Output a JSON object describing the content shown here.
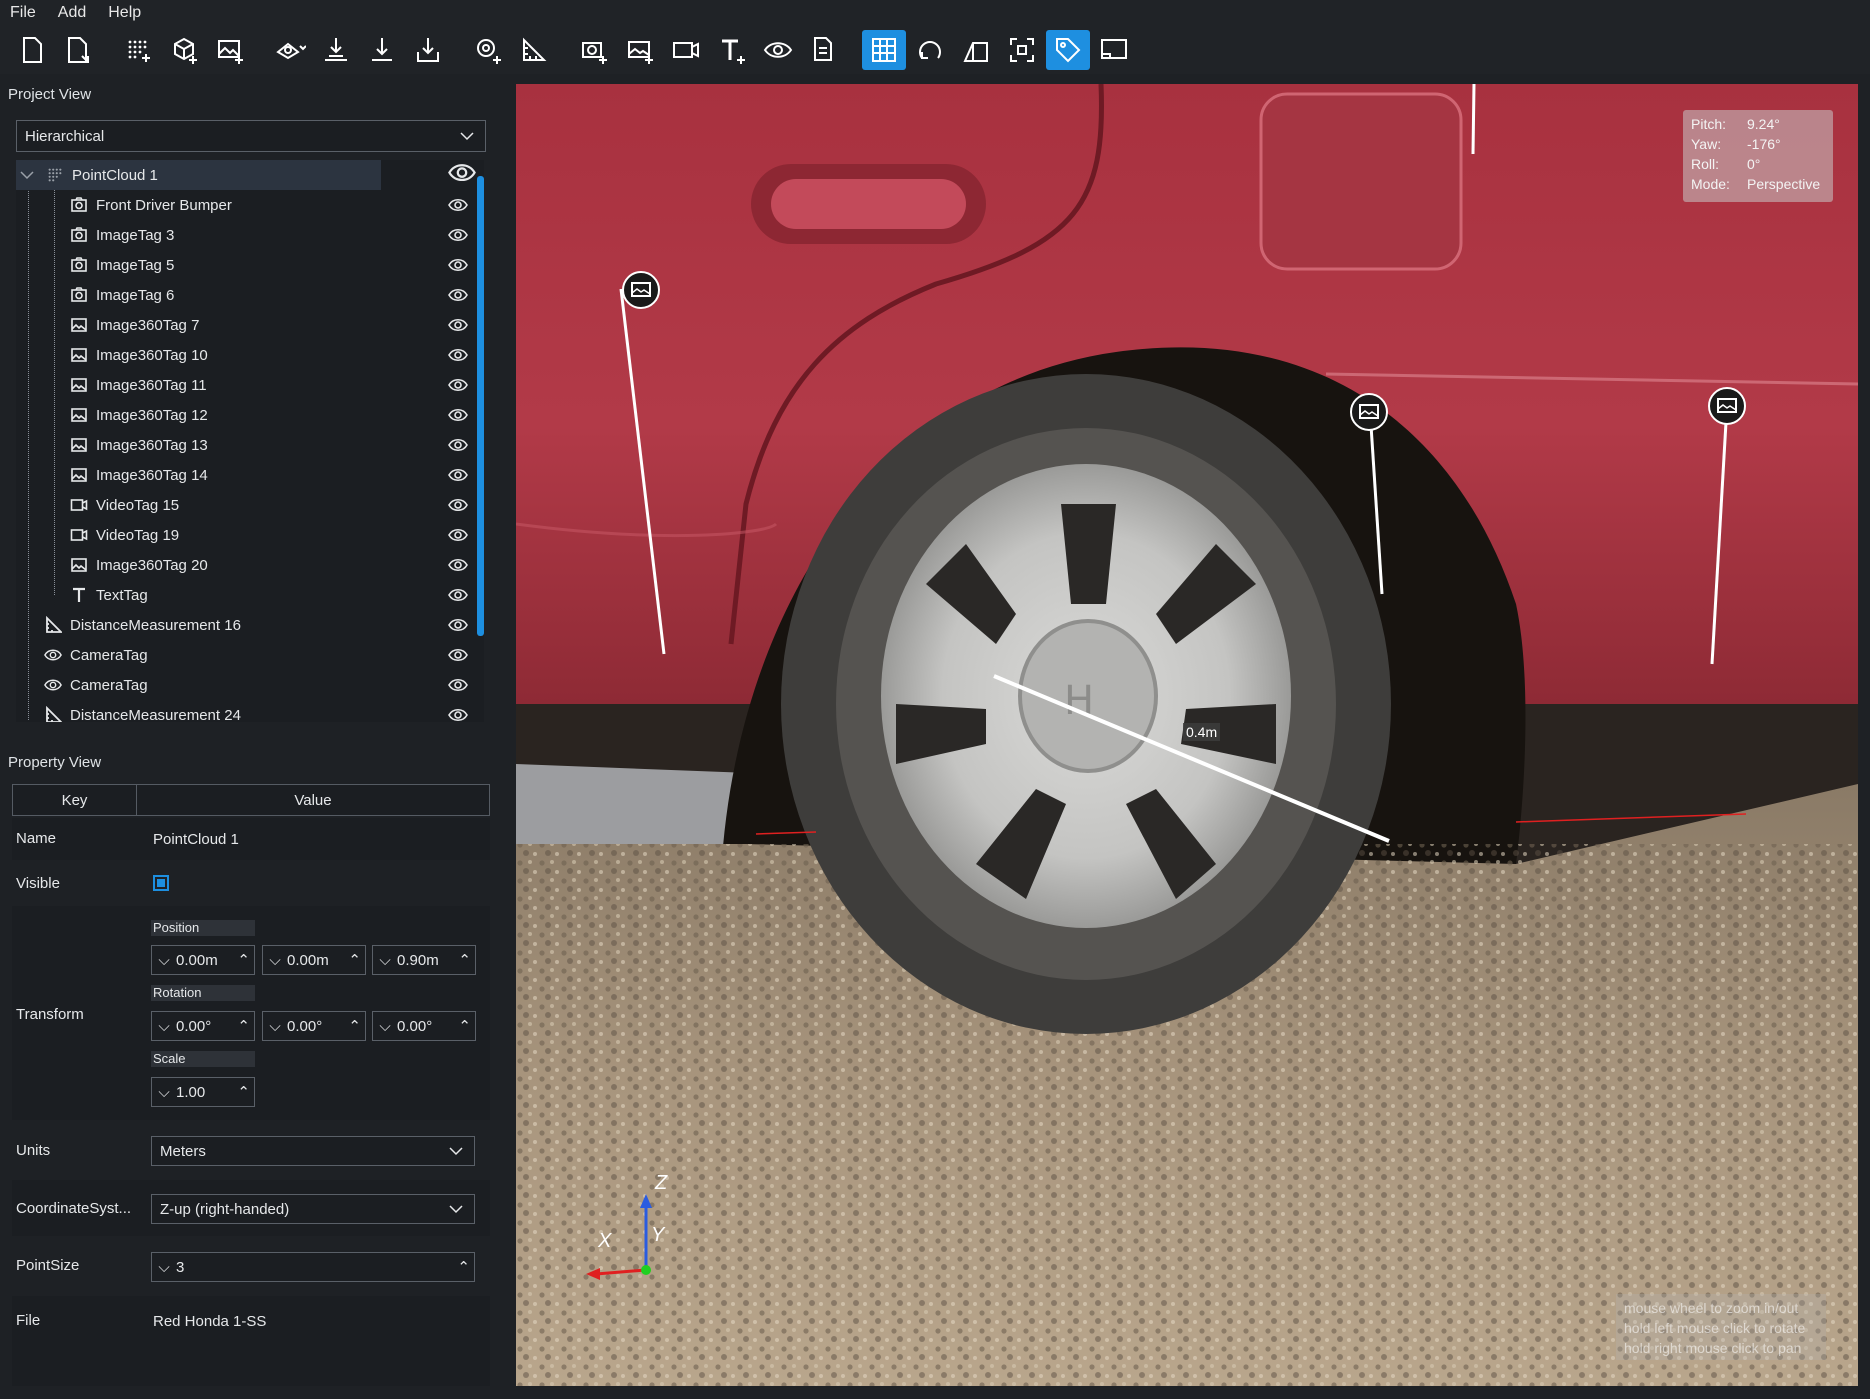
{
  "menu": [
    "File",
    "Add",
    "Help"
  ],
  "toolbar": {
    "icons": [
      "new-file-icon",
      "open-file-icon",
      "add-pointcloud-icon",
      "add-model-icon",
      "add-image-icon",
      "transform-icon",
      "drop-icon",
      "ground-icon",
      "import-icon",
      "pin-icon",
      "measure-icon",
      "camera-tag-icon",
      "image360-tag-icon",
      "video-tag-icon",
      "text-tag-icon",
      "eye-tag-icon",
      "doc-tag-icon",
      "grid-icon",
      "orbit-icon",
      "perspective-icon",
      "fit-icon",
      "tag-icon",
      "screen-icon"
    ],
    "active": [
      "grid-icon",
      "tag-icon"
    ]
  },
  "project_view": {
    "title": "Project View",
    "mode": "Hierarchical",
    "items": [
      {
        "label": "PointCloud 1",
        "icon": "pointcloud-icon",
        "level": 0
      },
      {
        "label": "Front Driver Bumper",
        "icon": "camera-icon",
        "level": 1
      },
      {
        "label": "ImageTag 3",
        "icon": "camera-icon",
        "level": 1
      },
      {
        "label": "ImageTag 5",
        "icon": "camera-icon",
        "level": 1
      },
      {
        "label": "ImageTag 6",
        "icon": "camera-icon",
        "level": 1
      },
      {
        "label": "Image360Tag 7",
        "icon": "image360-icon",
        "level": 1
      },
      {
        "label": "Image360Tag 10",
        "icon": "image360-icon",
        "level": 1
      },
      {
        "label": "Image360Tag 11",
        "icon": "image360-icon",
        "level": 1
      },
      {
        "label": "Image360Tag 12",
        "icon": "image360-icon",
        "level": 1
      },
      {
        "label": "Image360Tag 13",
        "icon": "image360-icon",
        "level": 1
      },
      {
        "label": "Image360Tag 14",
        "icon": "image360-icon",
        "level": 1
      },
      {
        "label": "VideoTag 15",
        "icon": "video-icon",
        "level": 1
      },
      {
        "label": "VideoTag 19",
        "icon": "video-icon",
        "level": 1
      },
      {
        "label": "Image360Tag 20",
        "icon": "image360-icon",
        "level": 1
      },
      {
        "label": "TextTag",
        "icon": "text-icon",
        "level": 1
      },
      {
        "label": "DistanceMeasurement 16",
        "icon": "measure-icon",
        "level": 0
      },
      {
        "label": "CameraTag",
        "icon": "eye-icon",
        "level": 0
      },
      {
        "label": "CameraTag",
        "icon": "eye-icon",
        "level": 0
      },
      {
        "label": "DistanceMeasurement 24",
        "icon": "measure-icon",
        "level": 0
      }
    ]
  },
  "property_view": {
    "title": "Property View",
    "header_key": "Key",
    "header_value": "Value",
    "name_key": "Name",
    "name_value": "PointCloud 1",
    "visible_key": "Visible",
    "transform_key": "Transform",
    "position_label": "Position",
    "position": [
      "0.00m",
      "0.00m",
      "0.90m"
    ],
    "rotation_label": "Rotation",
    "rotation": [
      "0.00°",
      "0.00°",
      "0.00°"
    ],
    "scale_label": "Scale",
    "scale": "1.00",
    "units_key": "Units",
    "units_value": "Meters",
    "coord_key": "CoordinateSyst...",
    "coord_value": "Z-up (right-handed)",
    "pointsize_key": "PointSize",
    "pointsize_value": "3",
    "file_key": "File",
    "file_value": "Red Honda 1-SS"
  },
  "viewport": {
    "hud": {
      "pitch_label": "Pitch:",
      "pitch": "9.24°",
      "yaw_label": "Yaw:",
      "yaw": "-176°",
      "roll_label": "Roll:",
      "roll": "0°",
      "mode_label": "Mode:",
      "mode": "Perspective"
    },
    "measurement": "0.4m",
    "axis_x": "X",
    "axis_y": "Y",
    "axis_z": "Z",
    "hint": [
      "mouse wheel to zoom in/out",
      "hold left mouse click to rotate",
      "hold right mouse click to pan"
    ]
  }
}
